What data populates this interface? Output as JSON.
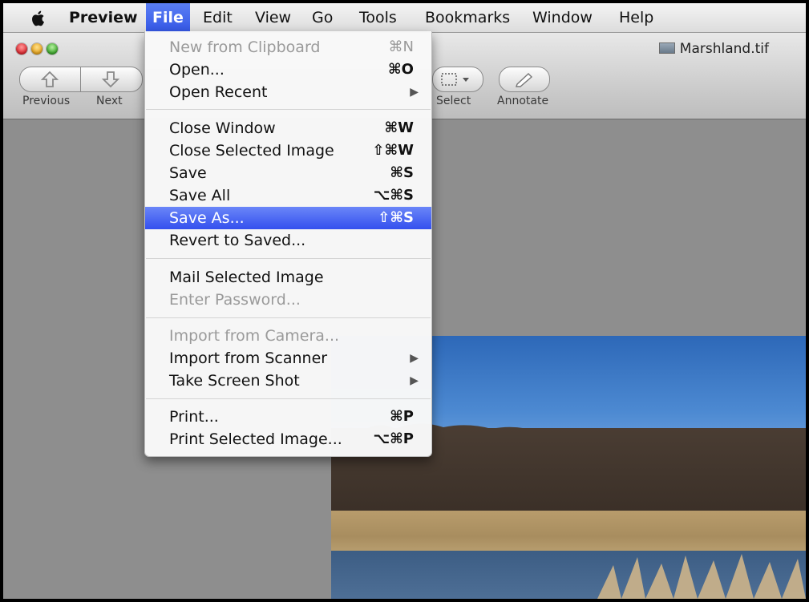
{
  "menubar": {
    "items": [
      {
        "label": "Preview"
      },
      {
        "label": "File"
      },
      {
        "label": "Edit"
      },
      {
        "label": "View"
      },
      {
        "label": "Go"
      },
      {
        "label": "Tools"
      },
      {
        "label": "Bookmarks"
      },
      {
        "label": "Window"
      },
      {
        "label": "Help"
      }
    ],
    "active": "File"
  },
  "window": {
    "title": "Marshland.tif",
    "toolbar": {
      "previous_label": "Previous",
      "next_label": "Next",
      "select_label": "Select",
      "annotate_label": "Annotate"
    }
  },
  "file_menu": {
    "items": [
      {
        "label": "New from Clipboard",
        "shortcut": "⌘N"
      },
      {
        "label": "Open...",
        "shortcut": "⌘O"
      },
      {
        "label": "Open Recent",
        "shortcut": ""
      },
      {
        "label": "Close Window",
        "shortcut": "⌘W"
      },
      {
        "label": "Close Selected Image",
        "shortcut": "⇧⌘W"
      },
      {
        "label": "Save",
        "shortcut": "⌘S"
      },
      {
        "label": "Save All",
        "shortcut": "⌥⌘S"
      },
      {
        "label": "Save As...",
        "shortcut": "⇧⌘S"
      },
      {
        "label": "Revert to Saved...",
        "shortcut": ""
      },
      {
        "label": "Mail Selected Image",
        "shortcut": ""
      },
      {
        "label": "Enter Password...",
        "shortcut": ""
      },
      {
        "label": "Import from Camera...",
        "shortcut": ""
      },
      {
        "label": "Import from Scanner",
        "shortcut": ""
      },
      {
        "label": "Take Screen Shot",
        "shortcut": ""
      },
      {
        "label": "Print...",
        "shortcut": "⌘P"
      },
      {
        "label": "Print Selected Image...",
        "shortcut": "⌥⌘P"
      }
    ],
    "highlighted": "Save As..."
  },
  "colors": {
    "highlight": "#3d5cf0",
    "disabled_text": "#9a9a9a",
    "menubar_bg": "#e6e6e6",
    "window_bg": "#8e8e8e"
  }
}
